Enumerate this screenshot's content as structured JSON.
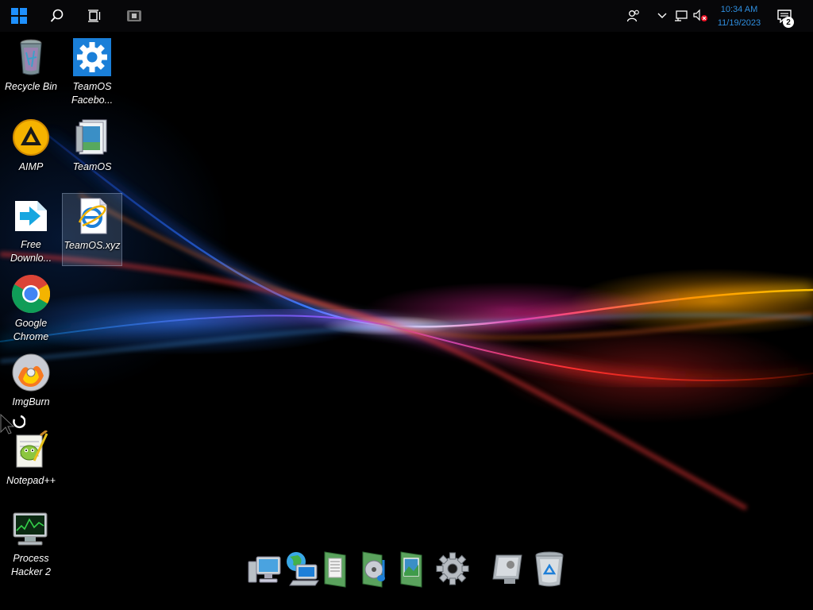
{
  "taskbar": {
    "start_icon": "windows-logo-icon",
    "search_icon": "search-icon",
    "task_view_icon": "task-view-icon",
    "app_icon": "app-icon",
    "tray": {
      "people_icon": "people-icon",
      "chevron_icon": "chevron-up-icon",
      "network_icon": "network-icon",
      "volume_icon": "volume-muted-icon"
    },
    "clock": {
      "time": "10:34 AM",
      "date": "11/19/2023"
    },
    "notifications": {
      "icon": "action-center-icon",
      "count": "2"
    },
    "accent_color": "#2f8fe0"
  },
  "desktop": {
    "icons": [
      {
        "label": "Recycle Bin",
        "icon": "recycle-bin-icon"
      },
      {
        "label": "TeamOS Facebo...",
        "icon": "settings-gear-icon"
      },
      {
        "label": "AIMP",
        "icon": "aimp-icon"
      },
      {
        "label": "TeamOS",
        "icon": "teamos-document-icon"
      },
      {
        "label": "Free Downlo...",
        "icon": "free-download-manager-icon"
      },
      {
        "label": "TeamOS.xyz",
        "icon": "internet-explorer-shortcut-icon"
      },
      {
        "label": "Google Chrome",
        "icon": "chrome-icon"
      },
      {
        "label": "ImgBurn",
        "icon": "imgburn-icon"
      },
      {
        "label": "Notepad++",
        "icon": "notepad-plus-plus-icon"
      },
      {
        "label": "Process Hacker 2",
        "icon": "process-hacker-icon"
      }
    ]
  },
  "dock": {
    "items": [
      {
        "icon": "computer-icon"
      },
      {
        "icon": "network-globe-icon"
      },
      {
        "icon": "documents-folder-icon"
      },
      {
        "icon": "music-folder-icon"
      },
      {
        "icon": "pictures-folder-icon"
      },
      {
        "icon": "settings-gear-icon"
      },
      {
        "icon": "control-panel-icon"
      },
      {
        "icon": "recycle-bin-icon"
      }
    ]
  }
}
